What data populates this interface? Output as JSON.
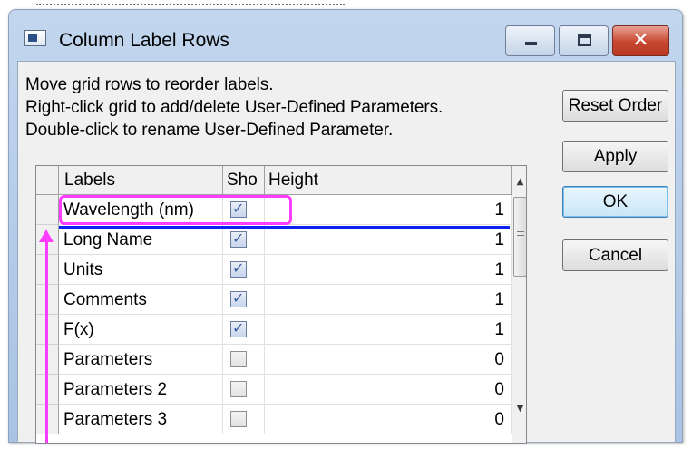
{
  "window": {
    "title": "Column Label Rows",
    "caption_buttons": [
      "minimize",
      "maximize",
      "close"
    ],
    "close_glyph": "✕"
  },
  "instructions": [
    "Move grid rows to reorder labels.",
    "Right-click grid to add/delete User-Defined Parameters.",
    "Double-click to rename User-Defined Parameter."
  ],
  "buttons": {
    "reset_order": "Reset Order",
    "apply": "Apply",
    "ok": "OK",
    "cancel": "Cancel"
  },
  "grid": {
    "columns": [
      "Labels",
      "Sho",
      "Height"
    ],
    "rows": [
      {
        "label": "Wavelength (nm)",
        "show": true,
        "height": "1"
      },
      {
        "label": "Long Name",
        "show": true,
        "height": "1"
      },
      {
        "label": "Units",
        "show": true,
        "height": "1"
      },
      {
        "label": "Comments",
        "show": true,
        "height": "1"
      },
      {
        "label": "F(x)",
        "show": true,
        "height": "1"
      },
      {
        "label": "Parameters",
        "show": false,
        "height": "0"
      },
      {
        "label": "Parameters 2",
        "show": false,
        "height": "0"
      },
      {
        "label": "Parameters 3",
        "show": false,
        "height": "0"
      }
    ]
  },
  "colors": {
    "highlight": "#ff3dff",
    "insert_line": "#0b22f2"
  }
}
